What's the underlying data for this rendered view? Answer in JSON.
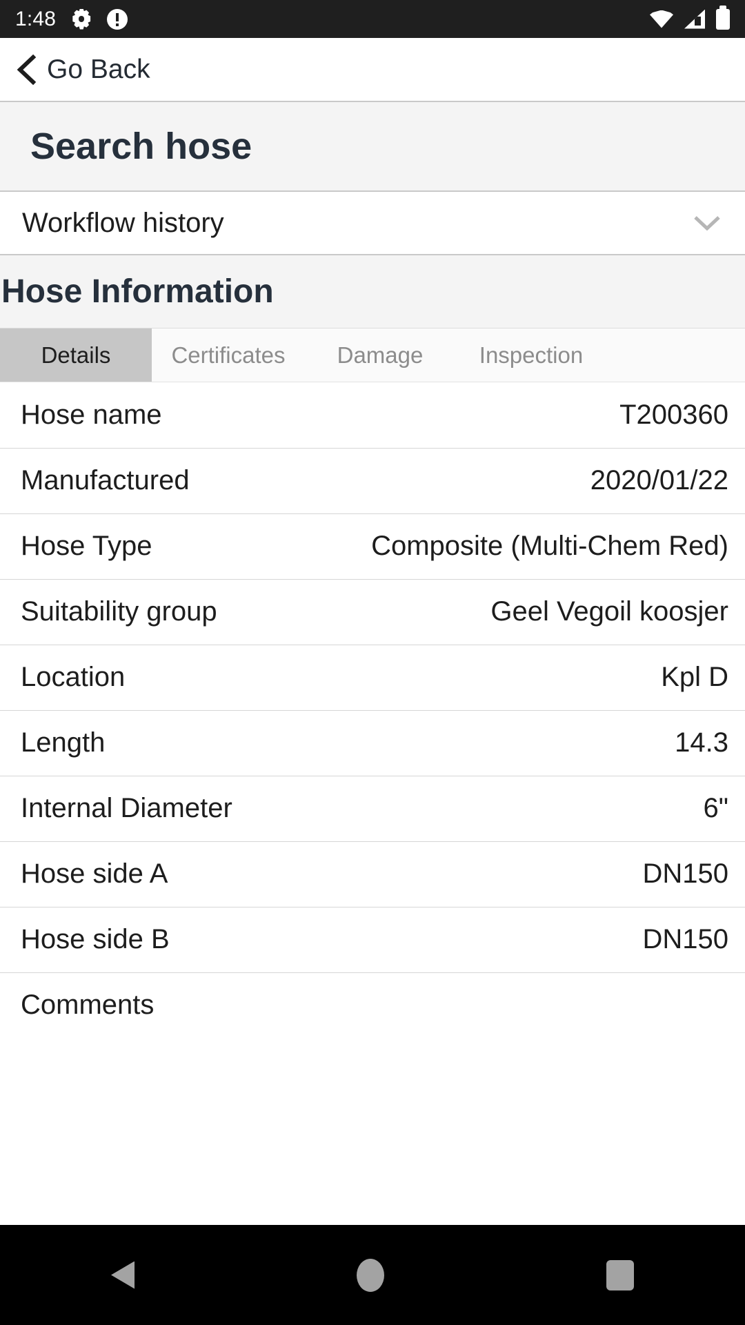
{
  "status_bar": {
    "time": "1:48",
    "icons_left": [
      "gear-icon",
      "alert-circle-icon"
    ],
    "icons_right": [
      "wifi-icon",
      "signal-icon",
      "battery-icon"
    ],
    "background": "#1f1f1f"
  },
  "nav": {
    "back_label": "Go Back",
    "back_icon": "chevron-left-icon"
  },
  "page": {
    "title": "Search hose"
  },
  "accordion": {
    "label": "Workflow history",
    "chevron": "chevron-down-icon"
  },
  "section": {
    "title": "Hose Information"
  },
  "tabs": {
    "active_index": 0,
    "items": [
      {
        "label": "Details"
      },
      {
        "label": "Certificates"
      },
      {
        "label": "Damage"
      },
      {
        "label": "Inspection"
      }
    ]
  },
  "details": {
    "rows": [
      {
        "label": "Hose name",
        "value": "T200360"
      },
      {
        "label": "Manufactured",
        "value": "2020/01/22"
      },
      {
        "label": "Hose Type",
        "value": "Composite (Multi-Chem Red)"
      },
      {
        "label": "Suitability group",
        "value": "Geel Vegoil koosjer"
      },
      {
        "label": "Location",
        "value": "Kpl D"
      },
      {
        "label": "Length",
        "value": "14.3"
      },
      {
        "label": "Internal Diameter",
        "value": "6\""
      },
      {
        "label": "Hose side A",
        "value": "DN150"
      },
      {
        "label": "Hose side B",
        "value": "DN150"
      },
      {
        "label": "Comments",
        "value": ""
      }
    ]
  },
  "system_nav": {
    "back": "triangle-back-icon",
    "home": "circle-home-icon",
    "recents": "square-recents-icon"
  },
  "colors": {
    "status_bar_bg": "#1f1f1f",
    "title_text": "#26303c",
    "panel_bg": "#f4f4f4",
    "active_tab_bg": "#c6c6c6",
    "inactive_tab_text": "#8c8c8c",
    "divider": "#d6d6d6",
    "nav_bar_bg": "#000000"
  }
}
